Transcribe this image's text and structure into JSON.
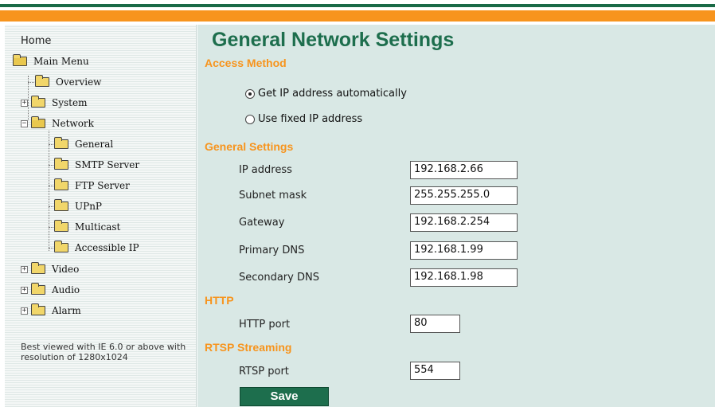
{
  "sidebar": {
    "home": "Home",
    "tree": {
      "main_menu": "Main Menu",
      "overview": "Overview",
      "system": "System",
      "network": "Network",
      "general": "General",
      "smtp": "SMTP Server",
      "ftp": "FTP Server",
      "upnp": "UPnP",
      "multicast": "Multicast",
      "accessible_ip": "Accessible IP",
      "video": "Video",
      "audio": "Audio",
      "alarm": "Alarm",
      "expand_symbol": "+",
      "collapse_symbol": "−"
    },
    "note": "Best viewed with IE 6.0 or above with resolution of 1280x1024"
  },
  "main": {
    "title": "General Network Settings",
    "access_method": {
      "heading": "Access Method",
      "option_auto": "Get IP address automatically",
      "option_fixed": "Use fixed IP address",
      "selected": "auto"
    },
    "general_settings": {
      "heading": "General Settings",
      "ip_label": "IP address",
      "ip_value": "192.168.2.66",
      "subnet_label": "Subnet mask",
      "subnet_value": "255.255.255.0",
      "gateway_label": "Gateway",
      "gateway_value": "192.168.2.254",
      "dns1_label": "Primary DNS",
      "dns1_value": "192.168.1.99",
      "dns2_label": "Secondary DNS",
      "dns2_value": "192.168.1.98"
    },
    "http": {
      "heading": "HTTP",
      "port_label": "HTTP port",
      "port_value": "80"
    },
    "rtsp": {
      "heading": "RTSP Streaming",
      "port_label": "RTSP port",
      "port_value": "554"
    },
    "save_label": "Save"
  },
  "colors": {
    "brand_green": "#1d6e4d",
    "accent_orange": "#f7941d",
    "panel_bg": "#d9e8e5"
  }
}
